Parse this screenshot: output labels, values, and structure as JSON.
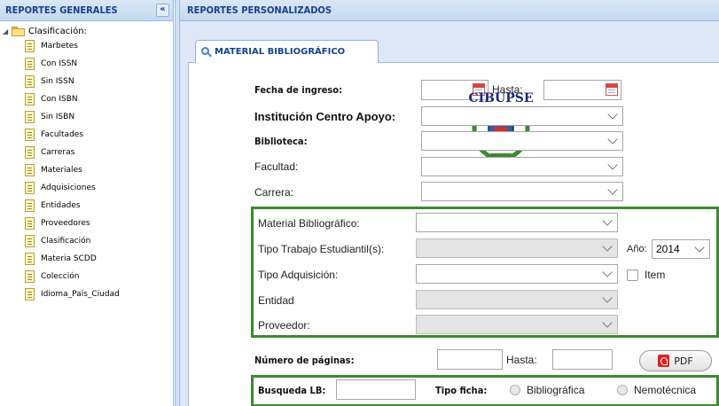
{
  "left_panel": {
    "title": "REPORTES GENERALES",
    "collapse_glyph": "«",
    "tree": {
      "root_label": "Clasificación:",
      "items": [
        {
          "label": "Marbetes"
        },
        {
          "label": "Con ISSN"
        },
        {
          "label": "Sin ISSN"
        },
        {
          "label": "Con ISBN"
        },
        {
          "label": "Sin ISBN"
        },
        {
          "label": "Facultades"
        },
        {
          "label": "Carreras"
        },
        {
          "label": "Materiales"
        },
        {
          "label": "Adquisiciones"
        },
        {
          "label": "Entidades"
        },
        {
          "label": "Proveedores"
        },
        {
          "label": "Clasificación"
        },
        {
          "label": "Materia SCDD"
        },
        {
          "label": "Colección"
        },
        {
          "label": "Idioma_País_Ciudad"
        }
      ]
    }
  },
  "right_panel": {
    "title": "REPORTES PERSONALIZADOS",
    "tab_label": "MATERIAL BIBLIOGRÁFICO",
    "logo_text": "CIBUPSE",
    "form": {
      "fecha_ingreso_label": "Fecha de ingreso:",
      "hasta_label": "Hasta:",
      "institucion_label": "Institución Centro Apoyo:",
      "biblioteca_label": "Biblioteca:",
      "facultad_label": "Facultad:",
      "carrera_label": "Carrera:",
      "material_label": "Material Bibliográfico:",
      "tipo_trabajo_label": "Tipo Trabajo Estudiantil(s):",
      "anio_label": "Año:",
      "anio_value": "2014",
      "tipo_adquisicion_label": "Tipo Adquisición:",
      "item_label": "Item",
      "entidad_label": "Entidad",
      "proveedor_label": "Proveedor:",
      "num_paginas_label": "Número de páginas:",
      "hasta2_label": "Hasta:",
      "pdf_label": "PDF",
      "busqueda_label": "Busqueda LB:",
      "tipo_ficha_label": "Tipo ficha:",
      "ficha_option1": "Bibliográfica",
      "ficha_option2": "Nemotécnica"
    }
  },
  "colors": {
    "header_text": "#15428b",
    "panel_border": "#99bbe8",
    "group_border": "#3a8a2e",
    "tree_link": "#000000"
  }
}
